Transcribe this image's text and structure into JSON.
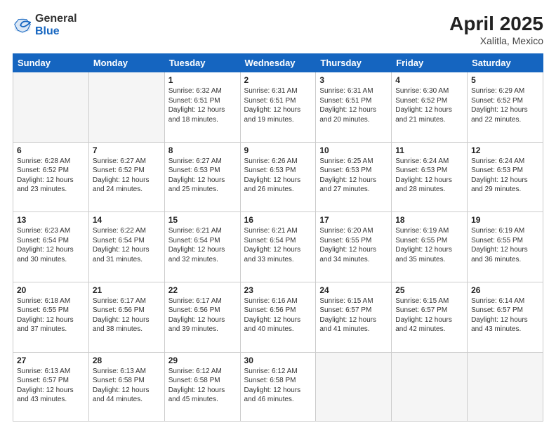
{
  "header": {
    "logo_general": "General",
    "logo_blue": "Blue",
    "month_title": "April 2025",
    "location": "Xalitla, Mexico"
  },
  "days_of_week": [
    "Sunday",
    "Monday",
    "Tuesday",
    "Wednesday",
    "Thursday",
    "Friday",
    "Saturday"
  ],
  "weeks": [
    [
      {
        "day": "",
        "info": ""
      },
      {
        "day": "",
        "info": ""
      },
      {
        "day": "1",
        "info": "Sunrise: 6:32 AM\nSunset: 6:51 PM\nDaylight: 12 hours and 18 minutes."
      },
      {
        "day": "2",
        "info": "Sunrise: 6:31 AM\nSunset: 6:51 PM\nDaylight: 12 hours and 19 minutes."
      },
      {
        "day": "3",
        "info": "Sunrise: 6:31 AM\nSunset: 6:51 PM\nDaylight: 12 hours and 20 minutes."
      },
      {
        "day": "4",
        "info": "Sunrise: 6:30 AM\nSunset: 6:52 PM\nDaylight: 12 hours and 21 minutes."
      },
      {
        "day": "5",
        "info": "Sunrise: 6:29 AM\nSunset: 6:52 PM\nDaylight: 12 hours and 22 minutes."
      }
    ],
    [
      {
        "day": "6",
        "info": "Sunrise: 6:28 AM\nSunset: 6:52 PM\nDaylight: 12 hours and 23 minutes."
      },
      {
        "day": "7",
        "info": "Sunrise: 6:27 AM\nSunset: 6:52 PM\nDaylight: 12 hours and 24 minutes."
      },
      {
        "day": "8",
        "info": "Sunrise: 6:27 AM\nSunset: 6:53 PM\nDaylight: 12 hours and 25 minutes."
      },
      {
        "day": "9",
        "info": "Sunrise: 6:26 AM\nSunset: 6:53 PM\nDaylight: 12 hours and 26 minutes."
      },
      {
        "day": "10",
        "info": "Sunrise: 6:25 AM\nSunset: 6:53 PM\nDaylight: 12 hours and 27 minutes."
      },
      {
        "day": "11",
        "info": "Sunrise: 6:24 AM\nSunset: 6:53 PM\nDaylight: 12 hours and 28 minutes."
      },
      {
        "day": "12",
        "info": "Sunrise: 6:24 AM\nSunset: 6:53 PM\nDaylight: 12 hours and 29 minutes."
      }
    ],
    [
      {
        "day": "13",
        "info": "Sunrise: 6:23 AM\nSunset: 6:54 PM\nDaylight: 12 hours and 30 minutes."
      },
      {
        "day": "14",
        "info": "Sunrise: 6:22 AM\nSunset: 6:54 PM\nDaylight: 12 hours and 31 minutes."
      },
      {
        "day": "15",
        "info": "Sunrise: 6:21 AM\nSunset: 6:54 PM\nDaylight: 12 hours and 32 minutes."
      },
      {
        "day": "16",
        "info": "Sunrise: 6:21 AM\nSunset: 6:54 PM\nDaylight: 12 hours and 33 minutes."
      },
      {
        "day": "17",
        "info": "Sunrise: 6:20 AM\nSunset: 6:55 PM\nDaylight: 12 hours and 34 minutes."
      },
      {
        "day": "18",
        "info": "Sunrise: 6:19 AM\nSunset: 6:55 PM\nDaylight: 12 hours and 35 minutes."
      },
      {
        "day": "19",
        "info": "Sunrise: 6:19 AM\nSunset: 6:55 PM\nDaylight: 12 hours and 36 minutes."
      }
    ],
    [
      {
        "day": "20",
        "info": "Sunrise: 6:18 AM\nSunset: 6:55 PM\nDaylight: 12 hours and 37 minutes."
      },
      {
        "day": "21",
        "info": "Sunrise: 6:17 AM\nSunset: 6:56 PM\nDaylight: 12 hours and 38 minutes."
      },
      {
        "day": "22",
        "info": "Sunrise: 6:17 AM\nSunset: 6:56 PM\nDaylight: 12 hours and 39 minutes."
      },
      {
        "day": "23",
        "info": "Sunrise: 6:16 AM\nSunset: 6:56 PM\nDaylight: 12 hours and 40 minutes."
      },
      {
        "day": "24",
        "info": "Sunrise: 6:15 AM\nSunset: 6:57 PM\nDaylight: 12 hours and 41 minutes."
      },
      {
        "day": "25",
        "info": "Sunrise: 6:15 AM\nSunset: 6:57 PM\nDaylight: 12 hours and 42 minutes."
      },
      {
        "day": "26",
        "info": "Sunrise: 6:14 AM\nSunset: 6:57 PM\nDaylight: 12 hours and 43 minutes."
      }
    ],
    [
      {
        "day": "27",
        "info": "Sunrise: 6:13 AM\nSunset: 6:57 PM\nDaylight: 12 hours and 43 minutes."
      },
      {
        "day": "28",
        "info": "Sunrise: 6:13 AM\nSunset: 6:58 PM\nDaylight: 12 hours and 44 minutes."
      },
      {
        "day": "29",
        "info": "Sunrise: 6:12 AM\nSunset: 6:58 PM\nDaylight: 12 hours and 45 minutes."
      },
      {
        "day": "30",
        "info": "Sunrise: 6:12 AM\nSunset: 6:58 PM\nDaylight: 12 hours and 46 minutes."
      },
      {
        "day": "",
        "info": ""
      },
      {
        "day": "",
        "info": ""
      },
      {
        "day": "",
        "info": ""
      }
    ]
  ]
}
